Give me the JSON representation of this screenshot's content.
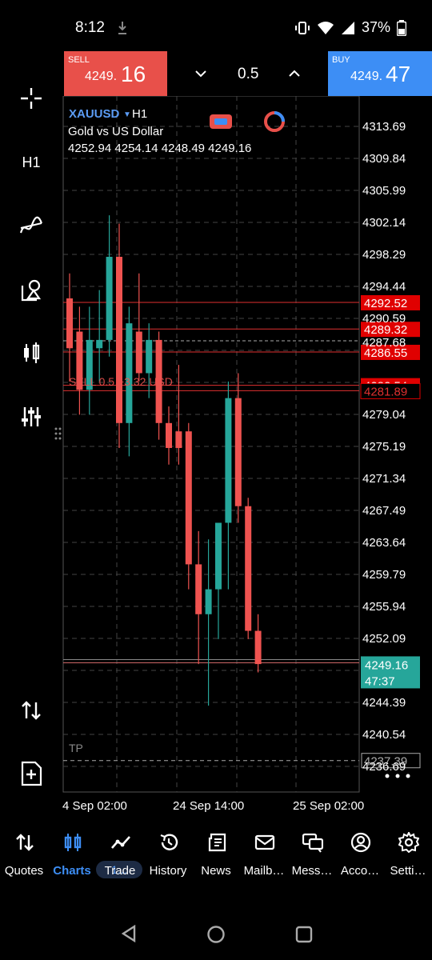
{
  "status": {
    "time": "8:12",
    "battery": "37%"
  },
  "trade": {
    "sell_label": "SELL",
    "sell_price_small": "4249.",
    "sell_price_big": "16",
    "buy_label": "BUY",
    "buy_price_small": "4249.",
    "buy_price_big": "47",
    "lot": "0.5"
  },
  "left_toolbar": {
    "timeframe": "H1"
  },
  "chart": {
    "symbol": "XAUUSD",
    "timeframe": "H1",
    "description": "Gold vs US Dollar",
    "ohlc": "4252.94 4254.14 4248.49 4249.16",
    "y_ticks": [
      "4313.69",
      "4309.84",
      "4305.99",
      "4302.14",
      "4298.29",
      "4294.44",
      "4290.59",
      "4287.68",
      "4279.04",
      "4275.19",
      "4271.34",
      "4267.49",
      "4263.64",
      "4259.79",
      "4255.94",
      "4252.09",
      "4244.39",
      "4240.54",
      "4236.69"
    ],
    "x_ticks": [
      "4 Sep 02:00",
      "24 Sep 14:00",
      "25 Sep 02:00"
    ],
    "level_labels": [
      "4292.52",
      "4289.32",
      "4286.55",
      "4282.54",
      "4281.89"
    ],
    "current_price": "4249.16",
    "countdown": "47:37",
    "tp_label": "TP",
    "tp_price": "4237.39",
    "position_text": "SELL 0.5  +3.32 USD",
    "candles": [
      {
        "o": 4293,
        "h": 4296,
        "l": 4283,
        "c": 4287
      },
      {
        "o": 4289,
        "h": 4292,
        "l": 4279,
        "c": 4282
      },
      {
        "o": 4282,
        "h": 4292,
        "l": 4279,
        "c": 4288
      },
      {
        "o": 4287,
        "h": 4294,
        "l": 4283,
        "c": 4288
      },
      {
        "o": 4288,
        "h": 4303,
        "l": 4286,
        "c": 4298
      },
      {
        "o": 4298,
        "h": 4302,
        "l": 4275,
        "c": 4278
      },
      {
        "o": 4278,
        "h": 4292,
        "l": 4274,
        "c": 4290
      },
      {
        "o": 4289,
        "h": 4296,
        "l": 4283,
        "c": 4284
      },
      {
        "o": 4284,
        "h": 4290,
        "l": 4281,
        "c": 4288
      },
      {
        "o": 4288,
        "h": 4289,
        "l": 4276,
        "c": 4278
      },
      {
        "o": 4278,
        "h": 4280,
        "l": 4273,
        "c": 4275
      },
      {
        "o": 4277,
        "h": 4285,
        "l": 4273,
        "c": 4275
      },
      {
        "o": 4277,
        "h": 4278,
        "l": 4258,
        "c": 4261
      },
      {
        "o": 4261,
        "h": 4265,
        "l": 4249,
        "c": 4255
      },
      {
        "o": 4255,
        "h": 4264,
        "l": 4244,
        "c": 4258
      },
      {
        "o": 4258,
        "h": 4266,
        "l": 4252,
        "c": 4266
      },
      {
        "o": 4266,
        "h": 4283,
        "l": 4258,
        "c": 4281
      },
      {
        "o": 4281,
        "h": 4284,
        "l": 4266,
        "c": 4268
      },
      {
        "o": 4268,
        "h": 4269,
        "l": 4252,
        "c": 4253
      },
      {
        "o": 4253,
        "h": 4255,
        "l": 4248,
        "c": 4249
      }
    ]
  },
  "bottom_nav": [
    {
      "label": "Quotes",
      "icon": "quotes-icon"
    },
    {
      "label": "Charts",
      "icon": "charts-icon",
      "badge": "1..."
    },
    {
      "label": "Trade",
      "icon": "trade-icon"
    },
    {
      "label": "History",
      "icon": "history-icon"
    },
    {
      "label": "News",
      "icon": "news-icon"
    },
    {
      "label": "Mailb…",
      "icon": "mailbox-icon"
    },
    {
      "label": "Mess…",
      "icon": "messages-icon"
    },
    {
      "label": "Acco…",
      "icon": "accounts-icon"
    },
    {
      "label": "Setti…",
      "icon": "settings-icon"
    }
  ],
  "colors": {
    "bull": "#26a69a",
    "bear": "#ef5350",
    "sell": "#e8504a",
    "buy": "#3d8ef5",
    "accent": "#3d8ef5"
  }
}
